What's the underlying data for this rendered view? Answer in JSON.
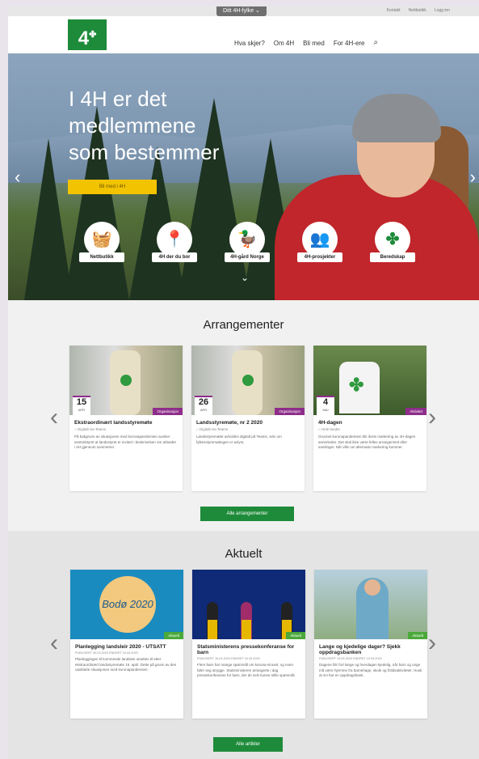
{
  "top": {
    "fylke": "Ditt 4H-fylke ⌄",
    "links": [
      "Kontakt",
      "Nettbutikk",
      "Logg inn"
    ]
  },
  "header": {
    "logo": "4H",
    "nav": [
      "Hva skjer?",
      "Om 4H",
      "Bli med",
      "For 4H-ere"
    ],
    "search_icon": "🔍"
  },
  "hero": {
    "title": "I 4H er det medlemmene som bestemmer",
    "cta": "Bli med i 4H",
    "prev": "‹",
    "next": "›",
    "down": "⌄",
    "quicklinks": [
      {
        "label": "Nettbutikk",
        "icon": "basket-icon",
        "glyph": "🧺"
      },
      {
        "label": "4H der du bor",
        "icon": "map-pin-icon",
        "glyph": "📍"
      },
      {
        "label": "4H-gård Norge",
        "icon": "duck-icon",
        "glyph": "🦆"
      },
      {
        "label": "4H-prosjekter",
        "icon": "people-icon",
        "glyph": "👥"
      },
      {
        "label": "Beredskap",
        "icon": "clover-icon",
        "glyph": "✤"
      }
    ]
  },
  "events": {
    "title": "Arrangementer",
    "button": "Alle arrangementer",
    "cards": [
      {
        "day": "15",
        "month": "APR",
        "tag": "Organisasjon",
        "title": "Ekstraordinært landsstyremøte",
        "location": "Digitalt via Teams",
        "text": "På bakgrunn av situasjonen med koronapandemien avviker sentralstyret at landsstyret er invitert i beskrivelsen om arbeidet i 4H gjennom sommeren."
      },
      {
        "day": "26",
        "month": "APR",
        "tag": "Organisasjon",
        "title": "Landsstyremøte, nr 2 2020",
        "location": "Digitalt via Teams",
        "text": "Landsstyremøtet avholdes digitalt på Teams, selv om fylkesstyremøtingen er avlyst."
      },
      {
        "day": "4",
        "month": "MAI",
        "tag": "Aktivitet",
        "title": "4H-dagen",
        "location": "Hele landet",
        "text": "Grunnet koronapandemien blir årets markering av 4H-dagen annerledes. Det skal ikke være felles arrangement eller samlinger. Når ville om alternativ markering kommer."
      }
    ]
  },
  "news": {
    "title": "Aktuelt",
    "button": "Alle artikler",
    "cards": [
      {
        "tag": "Aktuelt",
        "title": "Planlegging landsleir 2020 - UTSATT",
        "meta": "PUBLISERT 30.03.2020   ENDRET 15.04.2020",
        "text": "Planleggingen til kommende landsleir utsettes til etter ekstraordinært landsstyremøte 15. april. Dette på grunn av den uavklarte situasjonen med koronapandemien."
      },
      {
        "tag": "Aktuelt",
        "title": "Statsministerens pressekonferanse for barn",
        "meta": "PUBLISERT 16.03.2020   ENDRET 16.03.2020",
        "text": "Flere barn har mange spørsmål om korona-viruset, og noen føler seg utrygge. Statsministeren arrangerte i dag pressekonferanse for barn, der de selv kunne stille spørsmål."
      },
      {
        "tag": "Aktuelt",
        "title": "Lange og kjedelige dager? Sjekk oppdragsbanken",
        "meta": "PUBLISERT 19.03.2020   ENDRET 19.03.2020",
        "text": "Dagene blir fort lange og hverdagen kjedelig, når barn og unge må være hjemme fra barnehage, skole og fritidsaktiviteter. Husk at 4H har en oppdragsbank."
      }
    ]
  }
}
